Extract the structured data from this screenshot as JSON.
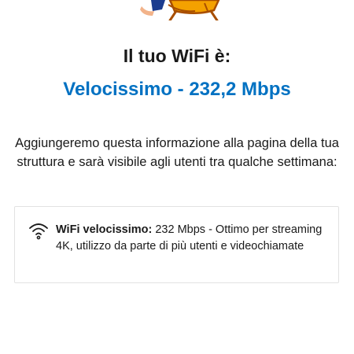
{
  "illustration": {
    "icon": "person-on-orange-chair-illustration",
    "colors": {
      "chair": "#f4a100",
      "chair_edge": "#a84e00",
      "clothing": "#1c3d8f"
    }
  },
  "heading": "Il tuo WiFi è:",
  "speed_label": "Velocissimo - 232,2 Mbps",
  "description": "Aggiungeremo questa informazione alla pagina della tua struttura e sarà visibile agli utenti tra qualche settimana:",
  "info_card": {
    "icon": "wifi-icon",
    "title": "WiFi velocissimo:",
    "body": " 232 Mbps - Ottimo per streaming 4K, utilizzo da parte di più utenti e videochiamate"
  },
  "colors": {
    "accent": "#0071c2",
    "text": "#1a1a1a",
    "card_border": "#e2e2e2"
  }
}
